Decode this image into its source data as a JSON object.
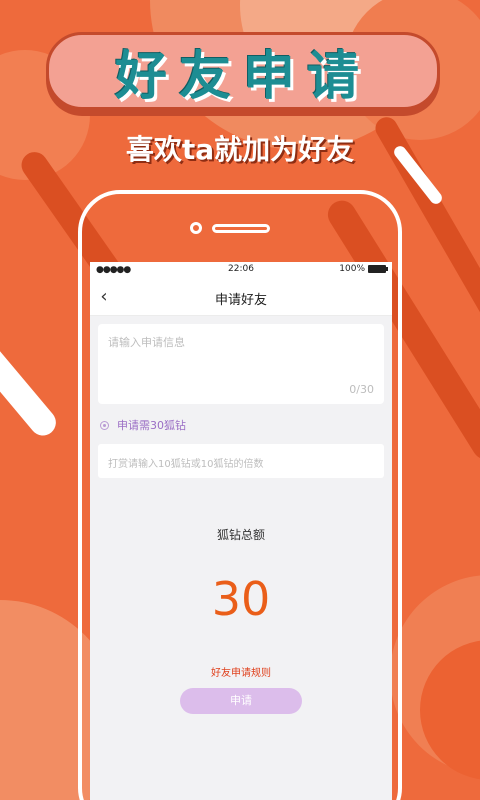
{
  "promo": {
    "banner_title": "好友申请",
    "subtitle": "喜欢ta就加为好友"
  },
  "status_bar": {
    "signal": "●●●●●",
    "time": "22:06",
    "battery": "100%"
  },
  "nav": {
    "back_icon": "‹",
    "title": "申请好友"
  },
  "form": {
    "message_placeholder": "请输入申请信息",
    "message_counter": "0/30",
    "requirement_label": "申请需30狐钻",
    "amount_placeholder": "打赏请输入10狐钻或10狐钻的倍数"
  },
  "summary": {
    "total_label": "狐钻总额",
    "total_value": "30"
  },
  "footer": {
    "rules_link": "好友申请规则",
    "apply_button": "申请"
  },
  "colors": {
    "background": "#ee6a3c",
    "accent_orange": "#ea5e19",
    "button_purple": "#dcbdeb",
    "radio_purple": "#9b6ec5"
  }
}
